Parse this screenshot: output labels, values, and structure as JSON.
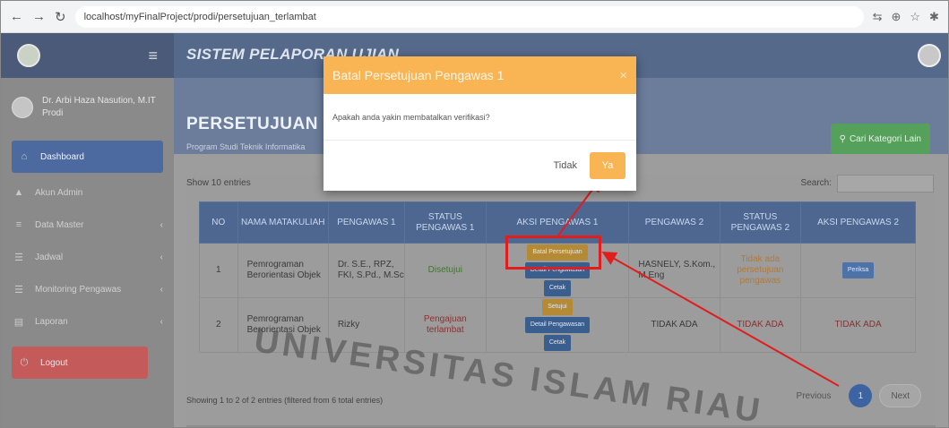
{
  "browser": {
    "url": "localhost/myFinalProject/prodi/persetujuan_terlambat"
  },
  "app": {
    "title": "SISTEM PELAPORAN UJIAN"
  },
  "sidebar": {
    "user_name": "Dr. Arbi Haza Nasution, M.IT",
    "user_sub": "Prodi",
    "items": [
      {
        "label": "Dashboard",
        "icon": "gauge-icon"
      },
      {
        "label": "Akun Admin",
        "icon": "user-icon"
      },
      {
        "label": "Data Master",
        "icon": "database-icon"
      },
      {
        "label": "Jadwal",
        "icon": "list-icon"
      },
      {
        "label": "Monitoring Pengawas",
        "icon": "list-icon"
      },
      {
        "label": "Laporan",
        "icon": "book-icon"
      },
      {
        "label": "Logout",
        "icon": "power-icon"
      }
    ]
  },
  "page": {
    "title": "PERSETUJUAN T",
    "subtitle": "Program Studi Teknik Informatika",
    "cari_button": "Cari Kategori Lain",
    "show_prefix": "Show",
    "show_value": "10",
    "show_suffix": "entries",
    "search_label": "Search:"
  },
  "table": {
    "headers": [
      "NO",
      "NAMA MATAKULIAH",
      "PENGAWAS 1",
      "STATUS PENGAWAS 1",
      "AKSI PENGAWAS 1",
      "PENGAWAS 2",
      "STATUS PENGAWAS 2",
      "AKSI PENGAWAS 2"
    ],
    "rows": [
      {
        "no": "1",
        "matkul": "Pemrograman Berorientasi Objek",
        "pengawas1": "Dr. S.E., RPZ, FKI, S.Pd., M.Sc",
        "status1": "Disetujui",
        "aksi1": [
          "Batal Persetujuan",
          "Detail Pengawasan",
          "Cetak"
        ],
        "pengawas2": "HASNELY, S.Kom., M.Eng",
        "status2": "Tidak ada persetujuan pengawas",
        "aksi2": [
          "Periksa"
        ]
      },
      {
        "no": "2",
        "matkul": "Pemrograman Berorientasi Objek",
        "pengawas1": "Rizky",
        "status1": "Pengajuan terlambat",
        "aksi1": [
          "Setujui",
          "Detail Pengawasan",
          "Cetak"
        ],
        "pengawas2": "TIDAK ADA",
        "status2": "TIDAK ADA",
        "aksi2": [
          "TIDAK ADA"
        ]
      }
    ],
    "info": "Showing 1 to 2 of 2 entries (filtered from 6 total entries)",
    "previous": "Previous",
    "current_page": "1",
    "next": "Next"
  },
  "modal": {
    "title": "Batal Persetujuan Pengawas 1",
    "close": "×",
    "body": "Apakah anda yakin membatalkan verifikasi?",
    "btn_no": "Tidak",
    "btn_yes": "Ya"
  },
  "watermark": "UNIVERSITAS ISLAM RIAU",
  "colors": {
    "topbar": "#55698a",
    "modal_accent": "#f9b454",
    "highlight": "#e11d1d",
    "pager_active": "#3c64a3"
  }
}
